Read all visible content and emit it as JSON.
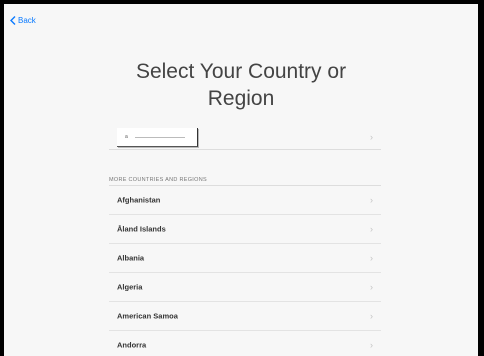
{
  "nav": {
    "back_label": "Back"
  },
  "header": {
    "title_line1": "Select Your Country or",
    "title_line2": "Region"
  },
  "suggested": {
    "text": "a"
  },
  "list": {
    "section_header": "MORE COUNTRIES AND REGIONS",
    "items": [
      {
        "label": "Afghanistan"
      },
      {
        "label": "Åland Islands"
      },
      {
        "label": "Albania"
      },
      {
        "label": "Algeria"
      },
      {
        "label": "American Samoa"
      },
      {
        "label": "Andorra"
      }
    ]
  },
  "colors": {
    "accent": "#0a7aff",
    "background": "#f7f7f7",
    "frame": "#000000"
  },
  "icons": {
    "back": "chevron-left-icon",
    "row": "chevron-right-icon"
  }
}
